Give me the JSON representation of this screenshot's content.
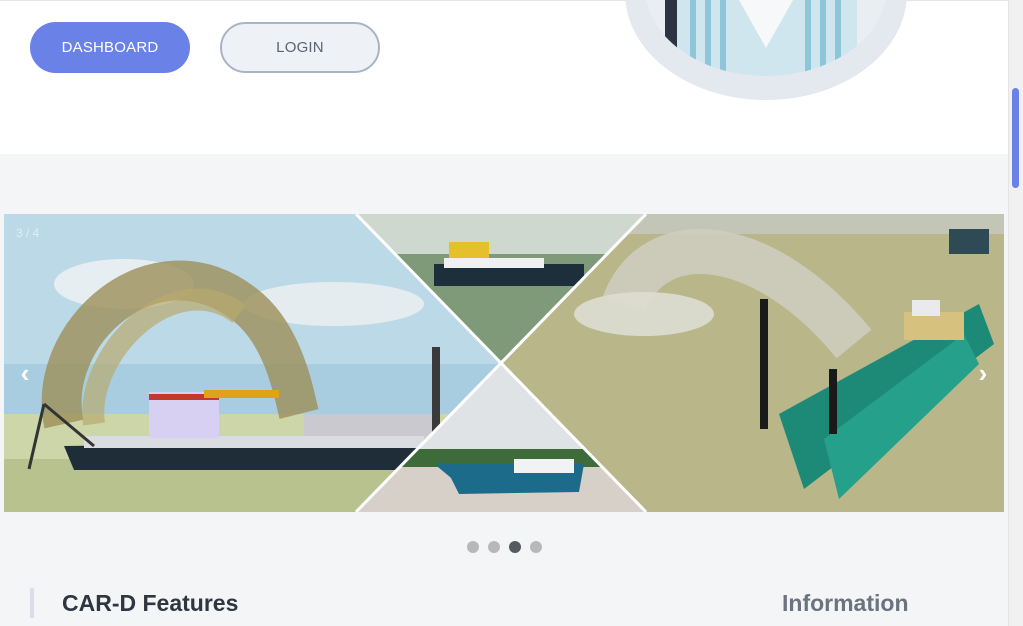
{
  "header": {
    "dashboard_label": "DASHBOARD",
    "login_label": "LOGIN"
  },
  "carousel": {
    "counter": "3 / 4",
    "prev_label": "‹",
    "next_label": "›",
    "slide_count": 4,
    "active_slide": 3
  },
  "sections": {
    "features_title": "CAR-D Features",
    "info_title": "Information"
  },
  "colors": {
    "accent": "#6a82e8",
    "water": "#b9b68a",
    "ship_hull": "#1d6b8a"
  }
}
